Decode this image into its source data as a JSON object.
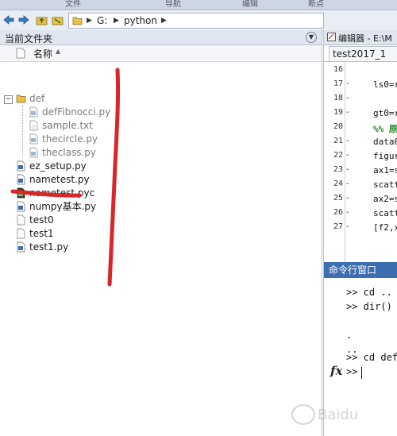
{
  "menu": {
    "tabs": [
      "文件",
      "导航",
      "编辑",
      "断点"
    ]
  },
  "address": {
    "path": [
      "G:",
      "python"
    ]
  },
  "file_panel": {
    "title": "当前文件夹",
    "column_header": "名称",
    "items": [
      {
        "name": "def",
        "type": "folder"
      },
      {
        "name": "defFibnocci.py",
        "type": "py"
      },
      {
        "name": "sample.txt",
        "type": "txt"
      },
      {
        "name": "thecircle.py",
        "type": "py"
      },
      {
        "name": "theclass.py",
        "type": "py"
      },
      {
        "name": "ez_setup.py",
        "type": "py"
      },
      {
        "name": "nametest.py",
        "type": "py"
      },
      {
        "name": "nametest.pyc",
        "type": "pyc"
      },
      {
        "name": "numpy基本.py",
        "type": "py"
      },
      {
        "name": "test0",
        "type": "file"
      },
      {
        "name": "test1",
        "type": "file"
      },
      {
        "name": "test1.py",
        "type": "py"
      }
    ]
  },
  "editor": {
    "title": "编辑器 - E:\\M",
    "tab": "test2017_1",
    "lines": [
      {
        "num": "16",
        "mark": "",
        "code": ""
      },
      {
        "num": "17",
        "mark": "-",
        "code": "ls0=r"
      },
      {
        "num": "18",
        "mark": "-",
        "code": ""
      },
      {
        "num": "19",
        "mark": "-",
        "code": "gt0=r"
      },
      {
        "num": "20",
        "mark": "",
        "code": "%% 原"
      },
      {
        "num": "21",
        "mark": "-",
        "code": "data0"
      },
      {
        "num": "22",
        "mark": "-",
        "code": "figur"
      },
      {
        "num": "23",
        "mark": "-",
        "code": "ax1=s"
      },
      {
        "num": "24",
        "mark": "-",
        "code": "scatt"
      },
      {
        "num": "25",
        "mark": "-",
        "code": "ax2=s"
      },
      {
        "num": "26",
        "mark": "-",
        "code": "scatt"
      },
      {
        "num": "27",
        "mark": "-",
        "code": "[f2,x"
      }
    ]
  },
  "command_window": {
    "title": "命令行窗口",
    "lines": [
      ">> cd ..",
      ">> dir()",
      "",
      ".",
      "..",
      "",
      ">> cd def"
    ],
    "prompt": ">>",
    "fx": "fx"
  },
  "colors": {
    "annotation_red": "#d8262a",
    "comment_green": "#228b22",
    "folder_yellow": "#e8c04a"
  }
}
